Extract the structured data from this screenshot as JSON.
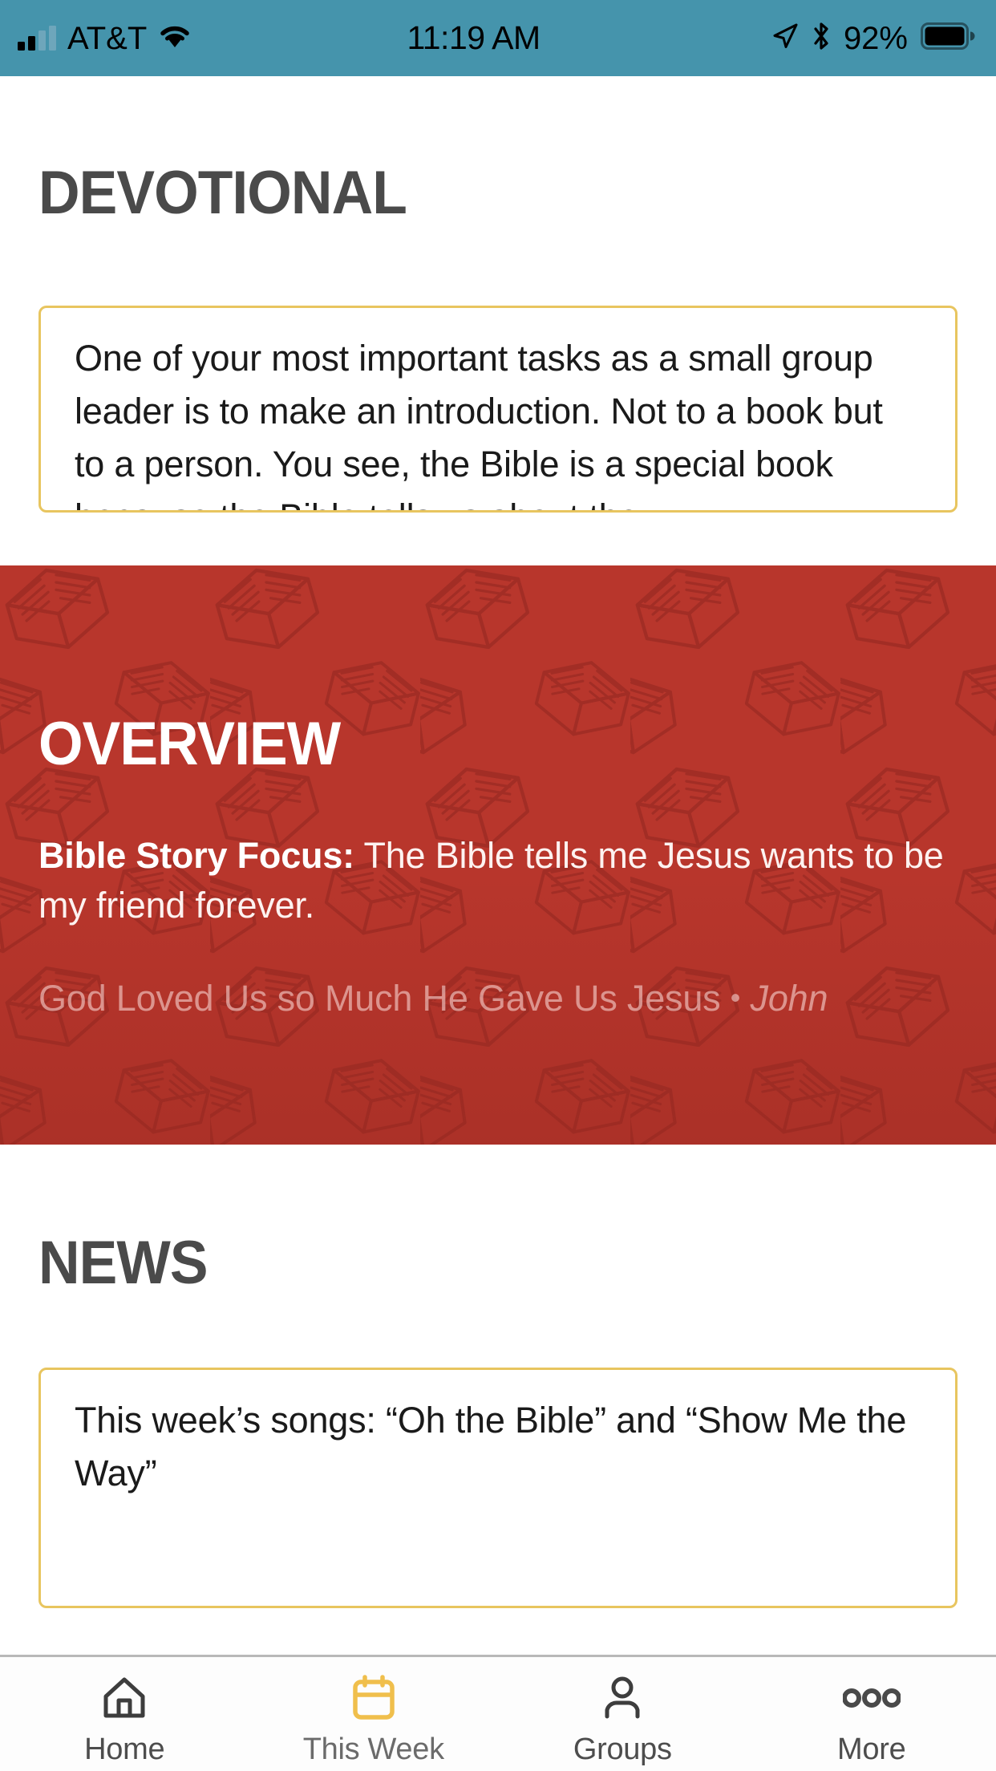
{
  "status_bar": {
    "carrier": "AT&T",
    "time": "11:19 AM",
    "battery_percent": "92%",
    "icons": [
      "signal-bars-icon",
      "wifi-icon",
      "location-arrow-icon",
      "bluetooth-icon",
      "battery-icon"
    ],
    "background_color": "#4594ac"
  },
  "devotional": {
    "title": "DEVOTIONAL",
    "body": "One of your most important tasks as a small group leader is to make an introduction. Not to a book but to a person. You see, the Bible is a special book because the Bible tells us about the",
    "border_color": "#e8c55f"
  },
  "overview": {
    "title": "OVERVIEW",
    "focus_label": "Bible Story Focus:",
    "focus_text": " The Bible tells me Jesus wants to be my friend forever.",
    "passage_title": "God Loved Us so Much He Gave Us Jesus",
    "passage_separator": "•",
    "passage_reference": "John",
    "background_color": "#b8362c"
  },
  "news": {
    "title": "NEWS",
    "body": "This week’s songs: “Oh the Bible” and “Show Me the Way”",
    "border_color": "#e8c55f"
  },
  "tabbar": {
    "active_color": "#f0bf4c",
    "items": [
      {
        "label": "Home",
        "icon": "home-icon",
        "active": false
      },
      {
        "label": "This Week",
        "icon": "calendar-icon",
        "active": true
      },
      {
        "label": "Groups",
        "icon": "person-icon",
        "active": false
      },
      {
        "label": "More",
        "icon": "ellipsis-icon",
        "active": false
      }
    ]
  }
}
